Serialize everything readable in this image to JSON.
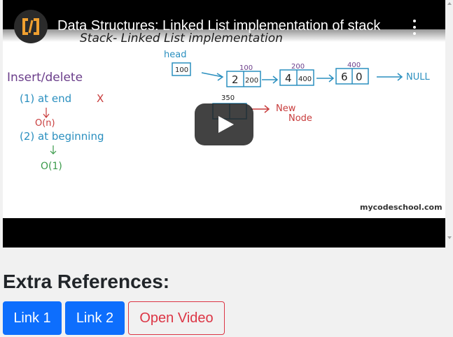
{
  "video": {
    "title": "Data Structures: Linked List implementation of stack",
    "channel_icon": "code-brackets-icon",
    "board": {
      "heading": "Stack- Linked List implementation",
      "head_label": "head",
      "head_value": "100",
      "node1": {
        "addr": "100",
        "data": "2",
        "next": "200"
      },
      "node2": {
        "addr": "200",
        "data": "4",
        "next": "400"
      },
      "node3": {
        "addr": "400",
        "data": "6",
        "next": "0"
      },
      "null_label": "NULL",
      "new_addr": "350",
      "new_label_line1": "New",
      "new_label_line2": "Node",
      "insert_delete": "Insert/delete",
      "at_end": "(1) at end",
      "mark_x": "X",
      "o_n": "O(n)",
      "at_beginning": "(2) at beginning",
      "o_1": "O(1)",
      "watermark": "mycodeschool.com"
    }
  },
  "references": {
    "heading": "Extra References:",
    "buttons": [
      {
        "label": "Link 1"
      },
      {
        "label": "Link 2"
      },
      {
        "label": "Open Video"
      }
    ]
  },
  "colors": {
    "primary": "#0d6efd",
    "danger": "#dc3545",
    "marker_blue": "#2a8fbf",
    "marker_green": "#3a9a4a",
    "marker_red": "#c83c3c",
    "marker_purple": "#6a3d8a"
  }
}
